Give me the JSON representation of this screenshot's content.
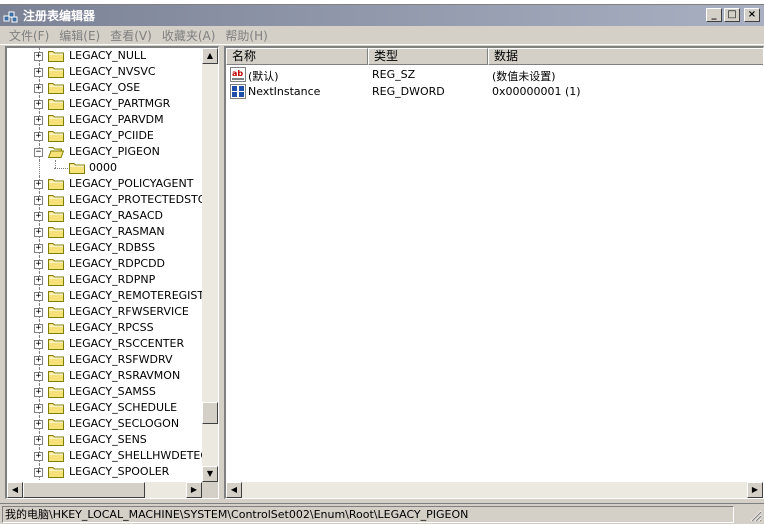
{
  "window": {
    "title": "注册表编辑器",
    "minimize": "_",
    "maximize": "□",
    "close": "×"
  },
  "menu": [
    {
      "label": "文件(F)"
    },
    {
      "label": "编辑(E)"
    },
    {
      "label": "查看(V)"
    },
    {
      "label": "收藏夹(A)"
    },
    {
      "label": "帮助(H)"
    }
  ],
  "tree": {
    "items": [
      {
        "label": "LEGACY_NULL",
        "expander": "+"
      },
      {
        "label": "LEGACY_NVSVC",
        "expander": "+"
      },
      {
        "label": "LEGACY_OSE",
        "expander": "+"
      },
      {
        "label": "LEGACY_PARTMGR",
        "expander": "+"
      },
      {
        "label": "LEGACY_PARVDM",
        "expander": "+"
      },
      {
        "label": "LEGACY_PCIIDE",
        "expander": "+"
      },
      {
        "label": "LEGACY_PIGEON",
        "expander": "−",
        "expanded": true,
        "selected": true
      },
      {
        "label": "0000",
        "child": true
      },
      {
        "label": "LEGACY_POLICYAGENT",
        "expander": "+"
      },
      {
        "label": "LEGACY_PROTECTEDSTORA",
        "expander": "+"
      },
      {
        "label": "LEGACY_RASACD",
        "expander": "+"
      },
      {
        "label": "LEGACY_RASMAN",
        "expander": "+"
      },
      {
        "label": "LEGACY_RDBSS",
        "expander": "+"
      },
      {
        "label": "LEGACY_RDPCDD",
        "expander": "+"
      },
      {
        "label": "LEGACY_RDPNP",
        "expander": "+"
      },
      {
        "label": "LEGACY_REMOTEREGISTRY",
        "expander": "+"
      },
      {
        "label": "LEGACY_RFWSERVICE",
        "expander": "+"
      },
      {
        "label": "LEGACY_RPCSS",
        "expander": "+"
      },
      {
        "label": "LEGACY_RSCCENTER",
        "expander": "+"
      },
      {
        "label": "LEGACY_RSFWDRV",
        "expander": "+"
      },
      {
        "label": "LEGACY_RSRAVMON",
        "expander": "+"
      },
      {
        "label": "LEGACY_SAMSS",
        "expander": "+"
      },
      {
        "label": "LEGACY_SCHEDULE",
        "expander": "+"
      },
      {
        "label": "LEGACY_SECLOGON",
        "expander": "+"
      },
      {
        "label": "LEGACY_SENS",
        "expander": "+"
      },
      {
        "label": "LEGACY_SHELLHWDETECTI",
        "expander": "+"
      },
      {
        "label": "LEGACY_SPOOLER",
        "expander": "+"
      }
    ],
    "scroll_up": "▲",
    "scroll_down": "▼",
    "scroll_left": "◀",
    "scroll_right": "▶"
  },
  "list": {
    "columns": [
      "名称",
      "类型",
      "数据"
    ],
    "rows": [
      {
        "name": "(默认)",
        "type": "REG_SZ",
        "data": "(数值未设置)",
        "icon": "string-value-icon"
      },
      {
        "name": "NextInstance",
        "type": "REG_DWORD",
        "data": "0x00000001 (1)",
        "icon": "binary-value-icon"
      }
    ],
    "scroll_left": "◀",
    "scroll_right": "▶"
  },
  "status": {
    "path": "我的电脑\\HKEY_LOCAL_MACHINE\\SYSTEM\\ControlSet002\\Enum\\Root\\LEGACY_PIGEON"
  },
  "colors": {
    "titlebar": "#7b8296",
    "folder": "#f7e27a",
    "face": "#d4d0c8"
  }
}
